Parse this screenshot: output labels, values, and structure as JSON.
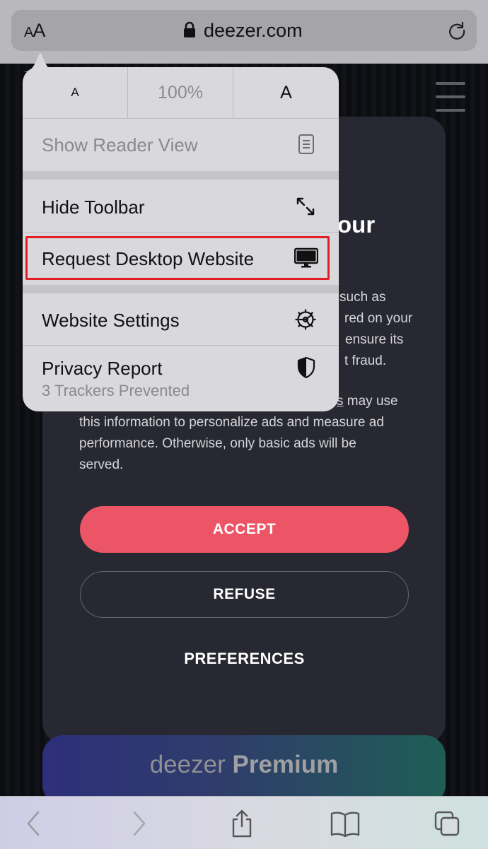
{
  "browser": {
    "aa_label_small": "A",
    "aa_label_large": "A",
    "url": "deezer.com"
  },
  "popover": {
    "zoom_small": "A",
    "zoom_percent": "100%",
    "zoom_large": "A",
    "items": [
      {
        "label": "Show Reader View",
        "icon": "reader-view-icon",
        "enabled": false
      },
      {
        "label": "Hide Toolbar",
        "icon": "expand-arrows-icon",
        "enabled": true
      },
      {
        "label": "Request Desktop Website",
        "icon": "desktop-icon",
        "enabled": true,
        "highlighted": true
      },
      {
        "label": "Website Settings",
        "icon": "gear-icon",
        "enabled": true
      },
      {
        "label": "Privacy Report",
        "sublabel": "3 Trackers Prevented",
        "icon": "shield-icon",
        "enabled": true
      }
    ]
  },
  "cookie_card": {
    "heading_fragment": "our",
    "text_fragments": [
      "such as",
      "red on your",
      "ensure its",
      "t fraud."
    ],
    "partial_line_link": "s",
    "partial_line_rest": " may use",
    "lines": [
      "this information to personalize ads and measure ad",
      "performance. Otherwise, only basic ads will be",
      "served."
    ],
    "accept_label": "ACCEPT",
    "refuse_label": "REFUSE",
    "preferences_label": "PREFERENCES"
  },
  "premium": {
    "brand": "deezer",
    "tier": "Premium"
  },
  "colors": {
    "accept": "#ec5566",
    "highlight": "#e01e26",
    "card": "#272832"
  }
}
